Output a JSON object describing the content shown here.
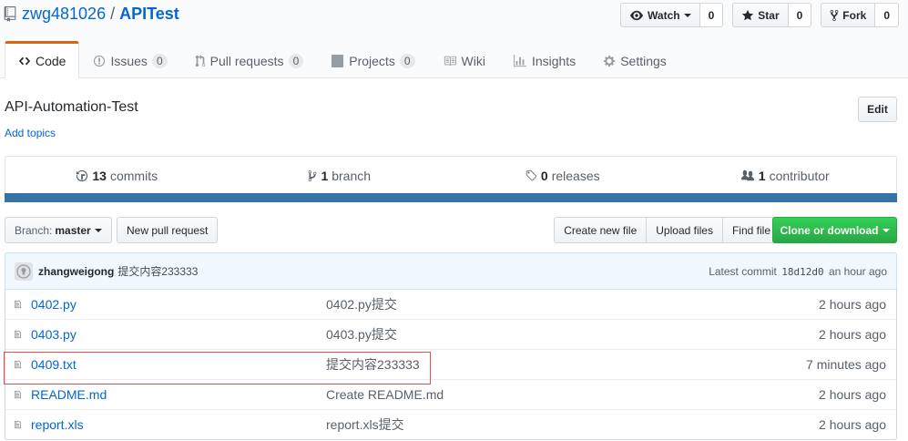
{
  "repo": {
    "owner": "zwg481026",
    "separator": "/",
    "name": "APITest"
  },
  "actions": {
    "watch": {
      "label": "Watch",
      "count": "0"
    },
    "star": {
      "label": "Star",
      "count": "0"
    },
    "fork": {
      "label": "Fork",
      "count": "0"
    }
  },
  "tabs": [
    {
      "label": "Code",
      "counter": ""
    },
    {
      "label": "Issues",
      "counter": "0"
    },
    {
      "label": "Pull requests",
      "counter": "0"
    },
    {
      "label": "Projects",
      "counter": "0"
    },
    {
      "label": "Wiki",
      "counter": ""
    },
    {
      "label": "Insights",
      "counter": ""
    },
    {
      "label": "Settings",
      "counter": ""
    }
  ],
  "description": "API-Automation-Test",
  "add_topics": "Add topics",
  "edit_label": "Edit",
  "summary": {
    "commits": {
      "num": "13",
      "label": "commits"
    },
    "branch": {
      "num": "1",
      "label": "branch"
    },
    "releases": {
      "num": "0",
      "label": "releases"
    },
    "contributors": {
      "num": "1",
      "label": "contributor"
    }
  },
  "language_color": "#3572A5",
  "file_nav": {
    "branch_prefix": "Branch:",
    "branch_name": "master",
    "new_pr": "New pull request",
    "create_file": "Create new file",
    "upload_files": "Upload files",
    "find_file": "Find file",
    "clone": "Clone or download"
  },
  "latest_commit": {
    "author": "zhangweigong",
    "message": "提交内容233333",
    "prefix": "Latest commit",
    "sha": "18d12d0",
    "time": "an hour ago"
  },
  "files": [
    {
      "name": "0402.py",
      "message": "0402.py提交",
      "age": "2 hours ago"
    },
    {
      "name": "0403.py",
      "message": "0403.py提交",
      "age": "2 hours ago"
    },
    {
      "name": "0409.txt",
      "message": "提交内容233333",
      "age": "7 minutes ago"
    },
    {
      "name": "README.md",
      "message": "Create README.md",
      "age": "2 hours ago"
    },
    {
      "name": "report.xls",
      "message": "report.xls提交",
      "age": "2 hours ago"
    }
  ]
}
